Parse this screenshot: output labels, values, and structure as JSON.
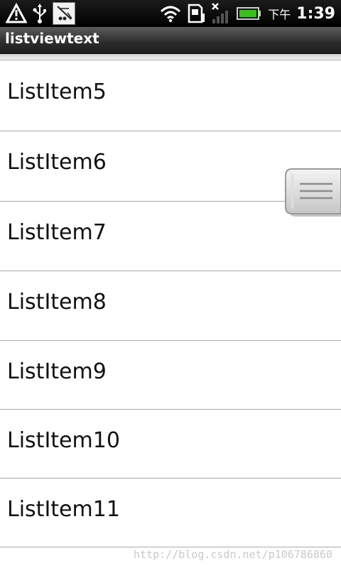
{
  "status_bar": {
    "icons": [
      "alert-icon",
      "usb-icon",
      "debug-icon",
      "wifi-icon",
      "sim-icon",
      "signal-icon",
      "battery-icon"
    ],
    "ampm": "下午",
    "time": "1:39"
  },
  "title_bar": {
    "title": "listviewtext"
  },
  "list": {
    "items": [
      {
        "label": "ListItem5"
      },
      {
        "label": "ListItem6"
      },
      {
        "label": "ListItem7"
      },
      {
        "label": "ListItem8"
      },
      {
        "label": "ListItem9"
      },
      {
        "label": "ListItem10"
      },
      {
        "label": "ListItem11"
      }
    ]
  },
  "watermark": "http://blog.csdn.net/p106786860",
  "colors": {
    "divider": "#a8a8a8",
    "battery": "#3bbf1a"
  }
}
